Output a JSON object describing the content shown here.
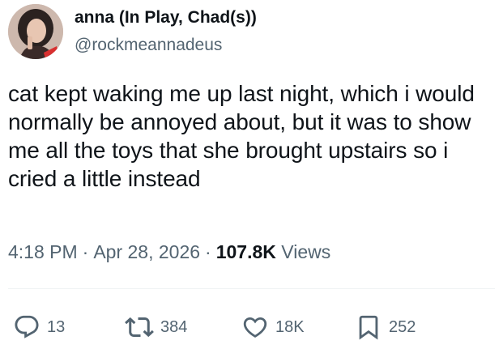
{
  "author": {
    "display_name": "anna (In Play, Chad(s))",
    "handle": "@rockmeannadeus",
    "avatar_icon": "profile-photo"
  },
  "tweet": {
    "text": "cat kept waking me up last night, which i would normally be annoyed about, but it was to show me all the toys that she brought upstairs so i cried a little instead",
    "time": "4:18 PM",
    "separator": "·",
    "date": "Apr 28, 2026",
    "views_count": "107.8K",
    "views_label": "Views"
  },
  "actions": {
    "reply": {
      "icon": "reply-icon",
      "count": "13"
    },
    "retweet": {
      "icon": "retweet-icon",
      "count": "384"
    },
    "like": {
      "icon": "heart-icon",
      "count": "18K"
    },
    "bookmark": {
      "icon": "bookmark-icon",
      "count": "252"
    }
  },
  "colors": {
    "text_primary": "#0f1419",
    "text_secondary": "#536471",
    "divider": "#eff3f4"
  }
}
